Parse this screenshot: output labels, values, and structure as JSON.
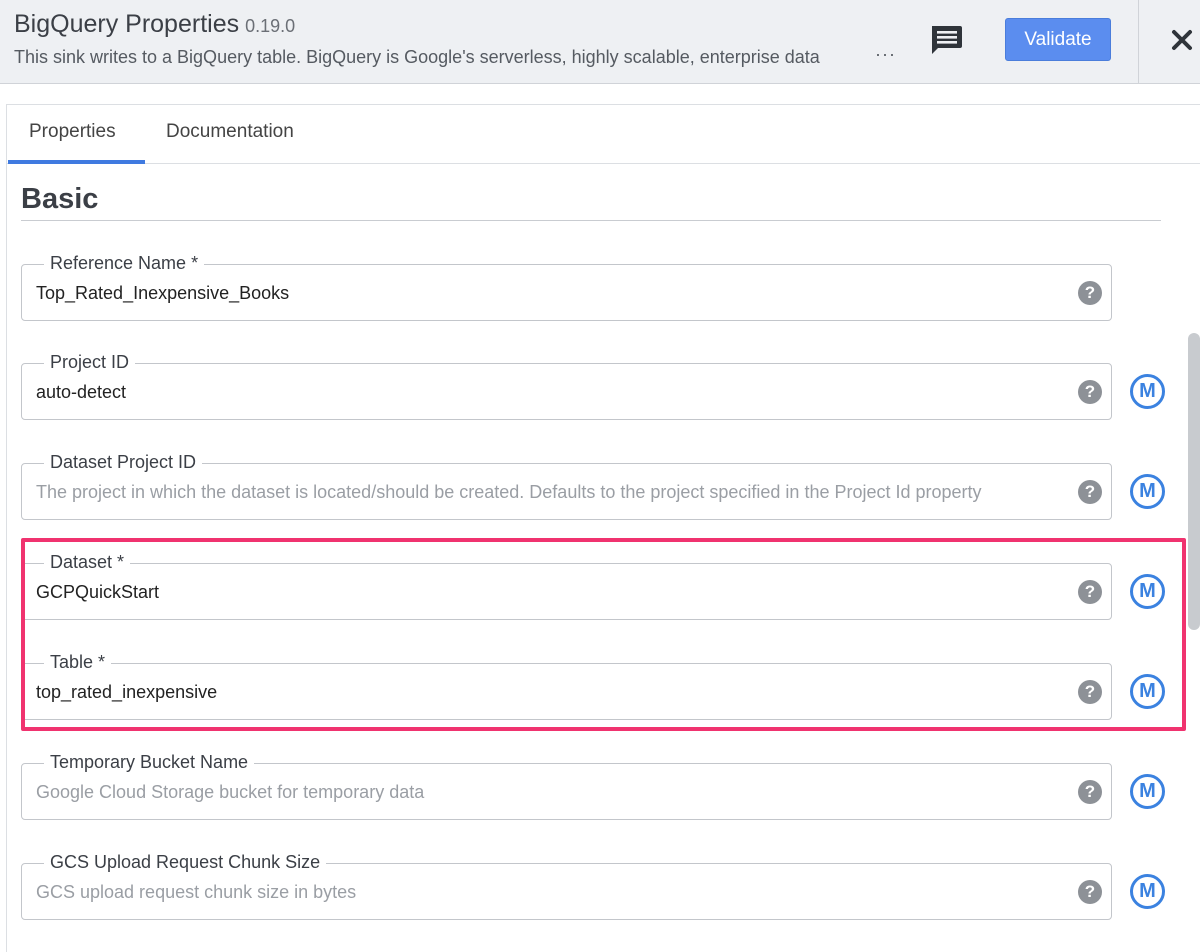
{
  "header": {
    "title": "BigQuery Properties",
    "version": "0.19.0",
    "description": "This sink writes to a BigQuery table. BigQuery is Google's serverless, highly scalable, enterprise data",
    "more": "···",
    "validate_label": "Validate",
    "comment_icon": "comment-icon",
    "close_icon": "close-icon"
  },
  "tabs": [
    {
      "label": "Properties",
      "active": true
    },
    {
      "label": "Documentation",
      "active": false
    }
  ],
  "section": {
    "title": "Basic"
  },
  "fields": [
    {
      "label": "Reference Name *",
      "value": "Top_Rated_Inexpensive_Books",
      "placeholder": "",
      "macro": false
    },
    {
      "label": "Project ID",
      "value": "auto-detect",
      "placeholder": "",
      "macro": true
    },
    {
      "label": "Dataset Project ID",
      "value": "",
      "placeholder": "The project in which the dataset is located/should be created. Defaults to the project specified in the Project Id property",
      "macro": true
    },
    {
      "label": "Dataset *",
      "value": "GCPQuickStart",
      "placeholder": "",
      "macro": true
    },
    {
      "label": "Table *",
      "value": "top_rated_inexpensive",
      "placeholder": "",
      "macro": true
    },
    {
      "label": "Temporary Bucket Name",
      "value": "",
      "placeholder": "Google Cloud Storage bucket for temporary data",
      "macro": true
    },
    {
      "label": "GCS Upload Request Chunk Size",
      "value": "",
      "placeholder": "GCS upload request chunk size in bytes",
      "macro": true
    }
  ],
  "help_glyph": "?",
  "macro_glyph": "M",
  "colors": {
    "accent": "#3f7ae0",
    "validate_button": "#5b8def",
    "macro_icon": "#3b82e0",
    "highlight_box": "#f0336f",
    "header_bg": "#eef0f3"
  }
}
